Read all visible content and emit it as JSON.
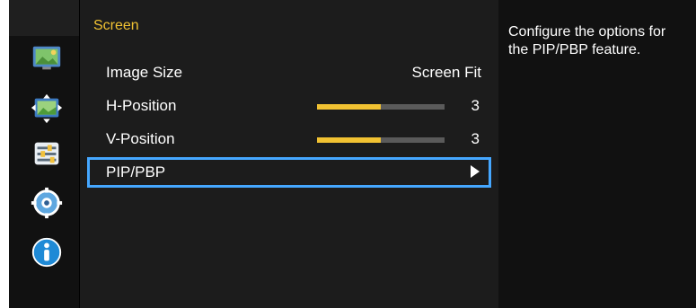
{
  "menu": {
    "title": "Screen",
    "items": [
      {
        "label": "Image Size",
        "value": "Screen Fit"
      },
      {
        "label": "H-Position",
        "value": "3",
        "level_fraction": 0.5
      },
      {
        "label": "V-Position",
        "value": "3",
        "level_fraction": 0.5
      },
      {
        "label": "PIP/PBP"
      }
    ]
  },
  "sidebar": {
    "icons": [
      "picture-icon",
      "screen-size-icon",
      "sliders-icon",
      "gear-icon",
      "info-icon"
    ]
  },
  "help": {
    "text": "Configure the options for the PIP/PBP feature."
  },
  "colors": {
    "accent": "#f1c232",
    "selection": "#45a7ff",
    "background": "#1c1c1c"
  }
}
